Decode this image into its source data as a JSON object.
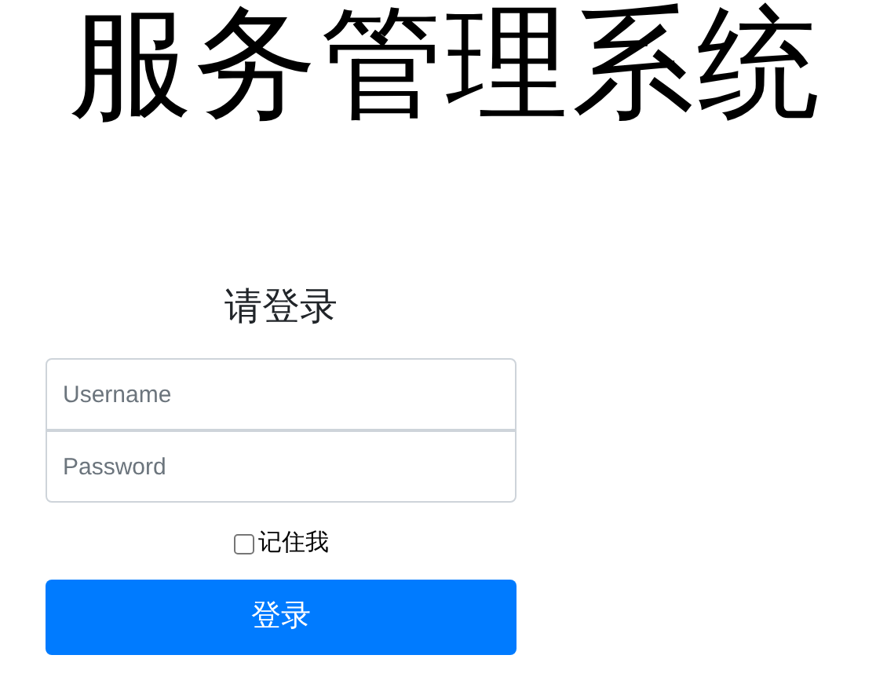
{
  "app_title": "服务管理系统",
  "form": {
    "heading": "请登录",
    "username": {
      "placeholder": "Username"
    },
    "password": {
      "placeholder": "Password"
    },
    "remember": {
      "label": "记住我",
      "checked": false
    },
    "submit": "登录"
  }
}
